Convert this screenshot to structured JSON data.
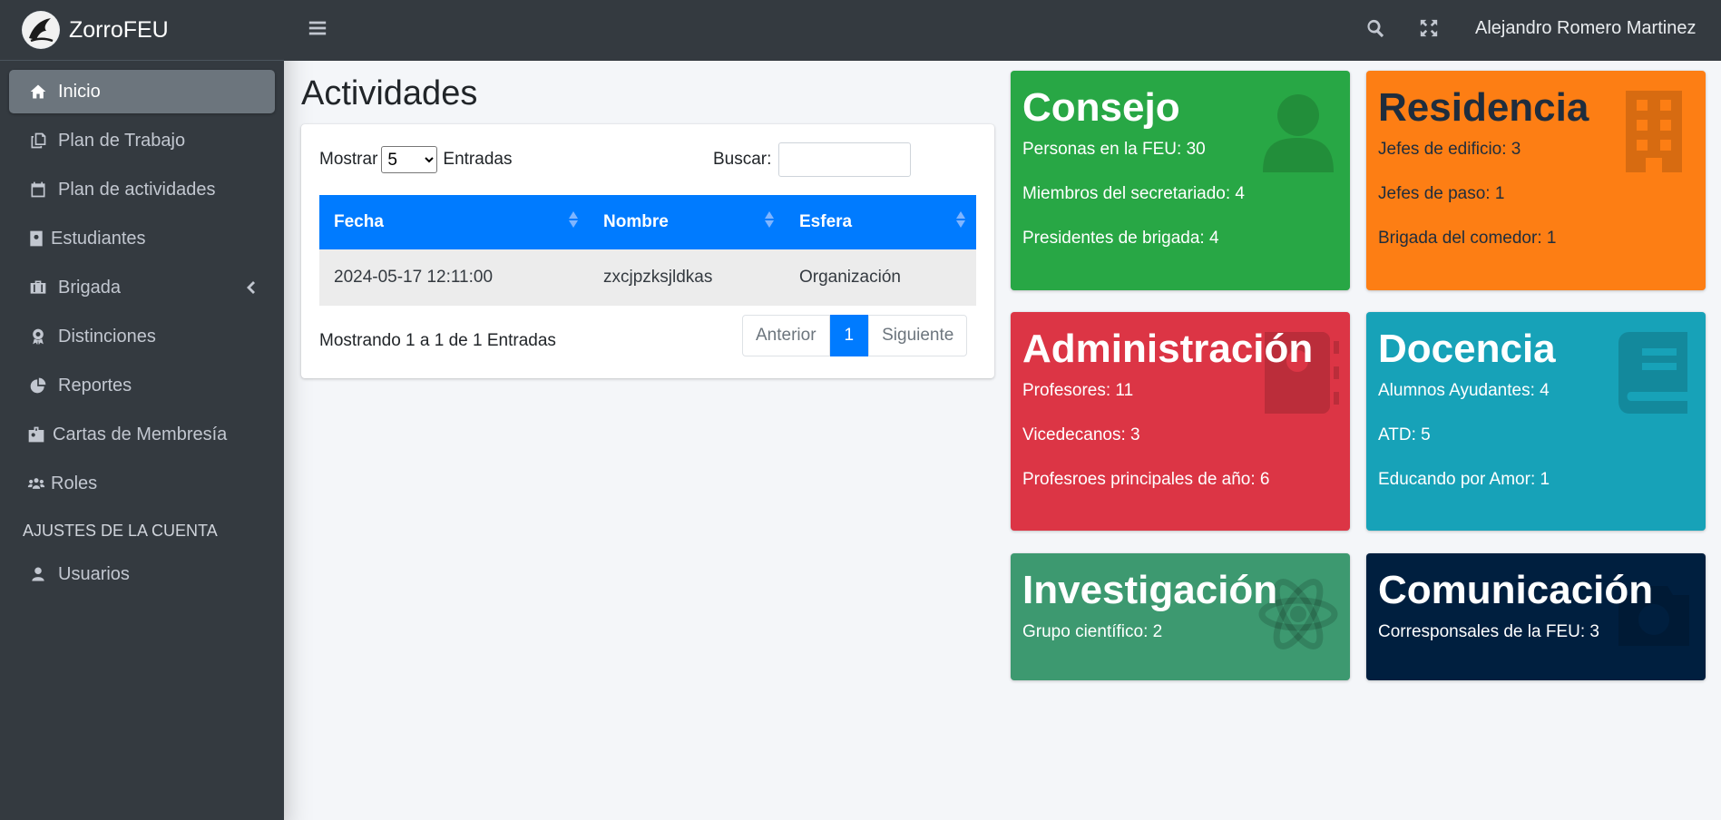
{
  "brand": {
    "name": "ZorroFEU"
  },
  "sidebar": {
    "items": [
      {
        "label": "Inicio",
        "icon": "home-icon"
      },
      {
        "label": "Plan de Trabajo",
        "icon": "copy-icon"
      },
      {
        "label": "Plan de actividades",
        "icon": "calendar-icon"
      },
      {
        "label": "Estudiantes",
        "icon": "id-card-icon"
      },
      {
        "label": "Brigada",
        "icon": "briefcase-icon"
      },
      {
        "label": "Distinciones",
        "icon": "award-icon"
      },
      {
        "label": "Reportes",
        "icon": "pie-chart-icon"
      },
      {
        "label": "Cartas de Membresía",
        "icon": "id-badge-icon"
      },
      {
        "label": "Roles",
        "icon": "users-icon"
      }
    ],
    "section_header": "AJUSTES DE LA CUENTA",
    "account_items": [
      {
        "label": "Usuarios",
        "icon": "user-icon"
      }
    ]
  },
  "topbar": {
    "user_name": "Alejandro Romero Martinez"
  },
  "main": {
    "title": "Actividades",
    "table": {
      "length_prefix": "Mostrar",
      "length_value": "5",
      "length_options": [
        "5"
      ],
      "length_suffix": "Entradas",
      "search_label": "Buscar:",
      "search_value": "",
      "columns": [
        "Fecha",
        "Nombre",
        "Esfera"
      ],
      "rows": [
        [
          "2024-05-17 12:11:00",
          "zxcjpzksjldkas",
          "Organización"
        ]
      ],
      "info": "Mostrando 1 a 1 de 1 Entradas",
      "pagination": {
        "prev": "Anterior",
        "current": "1",
        "next": "Siguiente"
      }
    }
  },
  "boxes": {
    "consejo": {
      "title": "Consejo",
      "icon": "user-icon",
      "color": "#28a745",
      "lines": [
        "Personas en la FEU: 30",
        "Miembros del secretariado: 4",
        "Presidentes de brigada: 4"
      ]
    },
    "residencia": {
      "title": "Residencia",
      "icon": "building-icon",
      "color": "#fd7e14",
      "lines": [
        "Jefes de edificio: 3",
        "Jefes de paso: 1",
        "Brigada del comedor: 1"
      ]
    },
    "administracion": {
      "title": "Administración",
      "icon": "address-book-icon",
      "color": "#dc3545",
      "lines": [
        "Profesores: 11",
        "Vicedecanos: 3",
        "Profesroes principales de año: 6"
      ]
    },
    "docencia": {
      "title": "Docencia",
      "icon": "book-icon",
      "color": "#17a2b8",
      "lines": [
        "Alumnos Ayudantes: 4",
        "ATD: 5",
        "Educando por Amor: 1"
      ]
    },
    "investigacion": {
      "title": "Investigación",
      "icon": "atom-icon",
      "color": "#3d9970",
      "lines": [
        "Grupo científico: 2"
      ]
    },
    "comunicacion": {
      "title": "Comunicación",
      "icon": "camera-icon",
      "color": "#001f3f",
      "lines": [
        "Corresponsales de la FEU: 3"
      ]
    }
  }
}
